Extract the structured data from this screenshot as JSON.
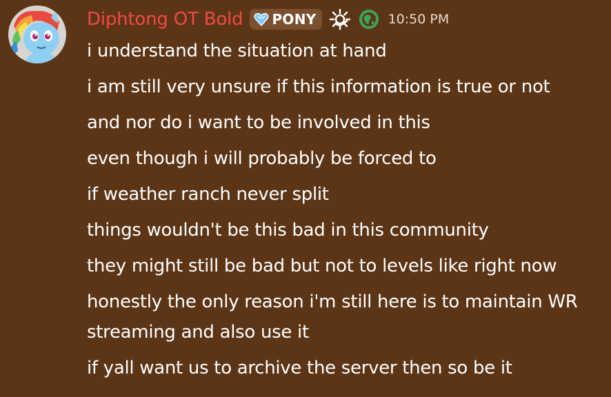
{
  "message": {
    "author": "Diphtong OT Bold",
    "author_color": "#f04a47",
    "role_tag": {
      "label": "PONY",
      "icon": "crystal-heart-icon"
    },
    "badges": [
      "sparkle-badge-icon",
      "globe-badge-icon"
    ],
    "timestamp": "10:50 PM",
    "lines": [
      "i understand the situation at hand",
      "i am still very unsure if this information is true or not",
      "and nor do i want to be involved in this",
      "even though i will probably be forced to",
      "if weather ranch never split",
      "things wouldn't be this bad in this community",
      "they might still be bad but not to levels like right now",
      "honestly the only reason i'm still here is to maintain WR streaming and also use it",
      "if yall want us to archive the server then so be it"
    ]
  },
  "colors": {
    "background": "#5c3516",
    "tag_background": "#7a5030",
    "timestamp": "#e8dbd0",
    "text": "#ffffff"
  }
}
